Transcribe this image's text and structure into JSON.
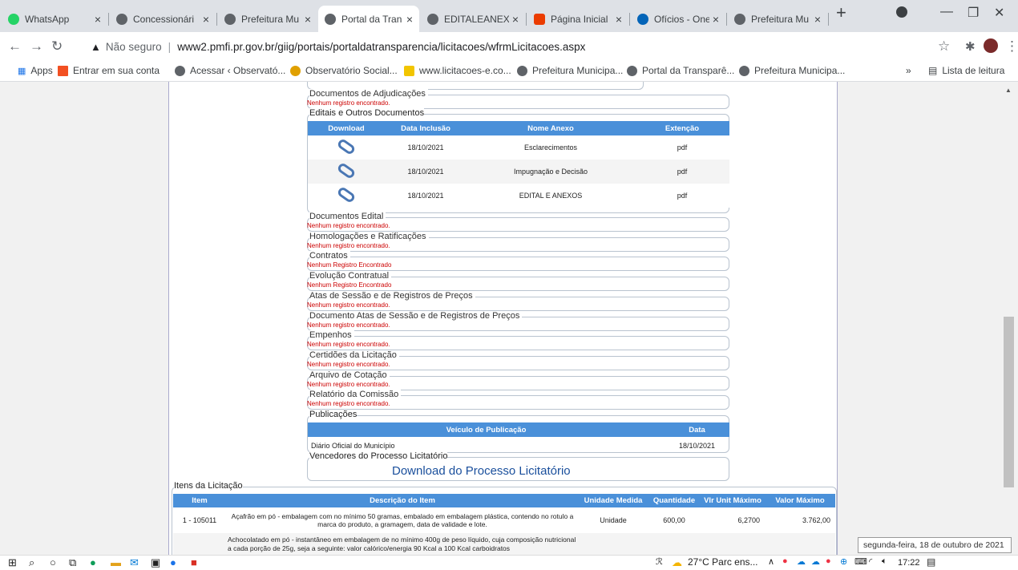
{
  "tabs": [
    {
      "title": "WhatsApp",
      "color": "#25d366"
    },
    {
      "title": "Concessionári",
      "color": "#5f6368"
    },
    {
      "title": "Prefeitura Mu",
      "color": "#5f6368"
    },
    {
      "title": "Portal da Tran",
      "color": "#5f6368"
    },
    {
      "title": "EDITALEANEX",
      "color": "#5f6368"
    },
    {
      "title": "Página Inicial",
      "color": "#eb3c00"
    },
    {
      "title": "Ofícios - OneD",
      "color": "#0364b8"
    },
    {
      "title": "Prefeitura Mu",
      "color": "#5f6368"
    }
  ],
  "address": {
    "security": "Não seguro",
    "url": "www2.pmfi.pr.gov.br/giig/portais/portaldatransparencia/licitacoes/wfrmLicitacoes.aspx"
  },
  "bookmarks": {
    "apps": "Apps",
    "items": [
      "Entrar em sua conta",
      "Acessar ‹ Observató...",
      "Observatório Social...",
      "www.licitacoes-e.co...",
      "Prefeitura Municipa...",
      "Portal da Transparê...",
      "Prefeitura Municipa..."
    ],
    "more": "»",
    "reading_list": "Lista de leitura"
  },
  "sections": {
    "adjudicacao": {
      "legend": "Documentos de Adjudicações",
      "msg": "Nenhum registro encontrado."
    },
    "editais": {
      "legend": "Editais e Outros Documentos",
      "headers": [
        "Download",
        "Data Inclusão",
        "Nome Anexo",
        "Extenção"
      ],
      "rows": [
        {
          "date": "18/10/2021",
          "name": "Esclarecimentos",
          "ext": "pdf"
        },
        {
          "date": "18/10/2021",
          "name": "Impugnação e Decisão",
          "ext": "pdf"
        },
        {
          "date": "18/10/2021",
          "name": "EDITAL E ANEXOS",
          "ext": "pdf"
        }
      ]
    },
    "list": [
      {
        "legend": "Documentos Edital",
        "msg": "Nenhum registro encontrado."
      },
      {
        "legend": "Homologações e Ratificações",
        "msg": "Nenhum registro encontrado."
      },
      {
        "legend": "Contratos",
        "msg": "Nenhum Registro Encontrado"
      },
      {
        "legend": "Evolução Contratual",
        "msg": "Nenhum Registro Encontrado"
      },
      {
        "legend": "Atas de Sessão e de Registros de Preços",
        "msg": "Nenhum registro encontrado."
      },
      {
        "legend": "Documento Atas de Sessão e de Registros de Preços",
        "msg": "Nenhum registro encontrado."
      },
      {
        "legend": "Empenhos",
        "msg": "Nenhum registro encontrado."
      },
      {
        "legend": "Certidões da Licitação",
        "msg": "Nenhum registro encontrado."
      },
      {
        "legend": "Arquivo de Cotação",
        "msg": "Nenhum registro encontrado."
      },
      {
        "legend": "Relatório da Comissão",
        "msg": "Nenhum registro encontrado."
      }
    ],
    "publicacoes": {
      "legend": "Publicações",
      "headers": [
        "Veículo de Publicação",
        "Data"
      ],
      "row": {
        "veiculo": "Diário Oficial do Município",
        "data": "18/10/2021"
      }
    },
    "vencedores": {
      "legend": "Vencedores do Processo Licitatório",
      "link": "Download do Processo Licitatório"
    },
    "itens": {
      "legend": "Itens da Licitação",
      "headers": [
        "Item",
        "Descrição do Item",
        "Unidade Medida",
        "Quantidade",
        "Vlr Unit Máximo",
        "Valor Máximo"
      ],
      "rows": [
        {
          "item": "1 - 105011",
          "desc": "Açafrão em pó - embalagem com no mínimo 50 gramas, embalado em embalagem plástica, contendo no rotulo a marca do produto, a gramagem, data de validade e lote.",
          "unidade": "Unidade",
          "qtd": "600,00",
          "unit": "6,2700",
          "valor": "3.762,00"
        },
        {
          "item": "",
          "desc": "Achocolatado em pó - instantâneo em embalagem de no mínimo 400g de peso líquido, cuja composição nutricional a cada porção de 25g, seja a seguinte: valor calórico/energia 90 Kcal a 100 Kcal carboidratos",
          "unidade": "",
          "qtd": "",
          "unit": "",
          "valor": ""
        }
      ]
    }
  },
  "taskbar": {
    "weather": "27°C  Parc ens...",
    "time": "17:22",
    "date_tooltip": "segunda-feira, 18 de outubro de 2021"
  }
}
